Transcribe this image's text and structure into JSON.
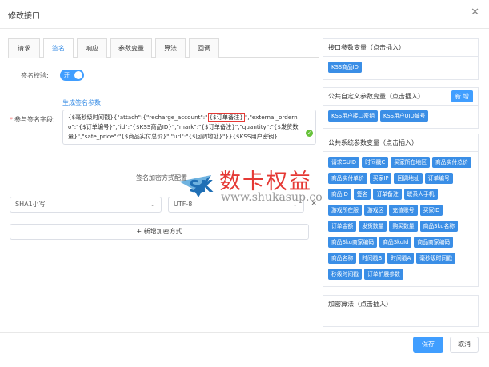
{
  "dialog": {
    "title": "修改接口",
    "close_icon": "close-icon"
  },
  "tabs": [
    {
      "label": "请求"
    },
    {
      "label": "签名"
    },
    {
      "label": "响应"
    },
    {
      "label": "参数变量"
    },
    {
      "label": "算法"
    },
    {
      "label": "回调"
    }
  ],
  "signature": {
    "toggle_label": "签名校验:",
    "toggle_value": "开",
    "generate_link": "生成签名参数",
    "field_label": "参与签名字段:",
    "value_part1": "{$毫秒级时间戳}{\"attach\":{\"recharge_account\":\"",
    "value_highlight": "{$订单备注}",
    "value_part2": "\",\"external_orderno\":\"{$订单编号}\",\"id\":\"{$KSS商品ID}\",\"mark\":\"{$订单备注}\",\"quantity\":\"{$发货数量}\",\"safe_price\":\"{$商品实付总价}\",\"url\":\"{$回调地址}\"}}{$KSS用户密钥}",
    "encrypt_title": "签名加密方式配置",
    "algo_select": "SHA1小写",
    "charset_select": "UTF-8",
    "remove_icon": "×",
    "add_button": "新增加密方式"
  },
  "watermark": {
    "brand": "SK",
    "cn": "数卡权益",
    "url": "www.shukasup.com"
  },
  "panels": {
    "interface_vars": {
      "title": "接口参数变量（点击插入）",
      "chips": [
        "KSS商品ID"
      ]
    },
    "custom_vars": {
      "title": "公共自定义参数变量（点击插入）",
      "new_button": "新 增",
      "chips": [
        "KSS用户接口密钥",
        "KSS用户UID编号"
      ]
    },
    "system_vars": {
      "title": "公共系统参数变量（点击插入）",
      "chips": [
        "请求GUID",
        "时间戳C",
        "买家所在地区",
        "商品实付总价",
        "商品实付单价",
        "买家IP",
        "回调地址",
        "订单编号",
        "商品ID",
        "签名",
        "订单备注",
        "联系人手机",
        "游戏所在服",
        "游戏区",
        "充值账号",
        "买家ID",
        "订单金额",
        "发货数量",
        "购买数量",
        "商品Sku名称",
        "商品Sku商家编码",
        "商品SkuId",
        "商品商家编码",
        "商品名称",
        "时间戳B",
        "时间戳A",
        "毫秒级时间戳",
        "秒级时间戳",
        "订单扩展参数"
      ]
    },
    "algorithms": {
      "title": "加密算法（点击插入）"
    }
  },
  "footer": {
    "save": "保存",
    "cancel": "取消"
  }
}
